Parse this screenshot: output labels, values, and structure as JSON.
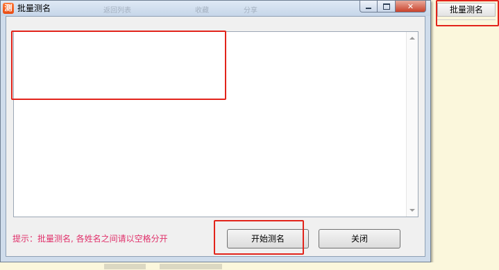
{
  "window": {
    "title": "批量测名",
    "icon": "app-logo-icon",
    "icon_glyph": "测",
    "controls": {
      "minimize": "minimize-icon",
      "maximize": "maximize-icon",
      "close": "close-icon",
      "close_glyph": "✕"
    },
    "background_ghost_text": [
      "返回列表",
      "收藏",
      "分享"
    ]
  },
  "main": {
    "names_textarea": {
      "value": ""
    },
    "hint": "提示：批量测名, 各姓名之间请以空格分开",
    "buttons": {
      "start": "开始测名",
      "close": "关闭"
    }
  },
  "side_panel": {
    "tab_label": "批量测名"
  },
  "colors": {
    "hint_text": "#e0306a",
    "highlight_box": "#e2231a",
    "side_background": "#fbf7dc"
  }
}
